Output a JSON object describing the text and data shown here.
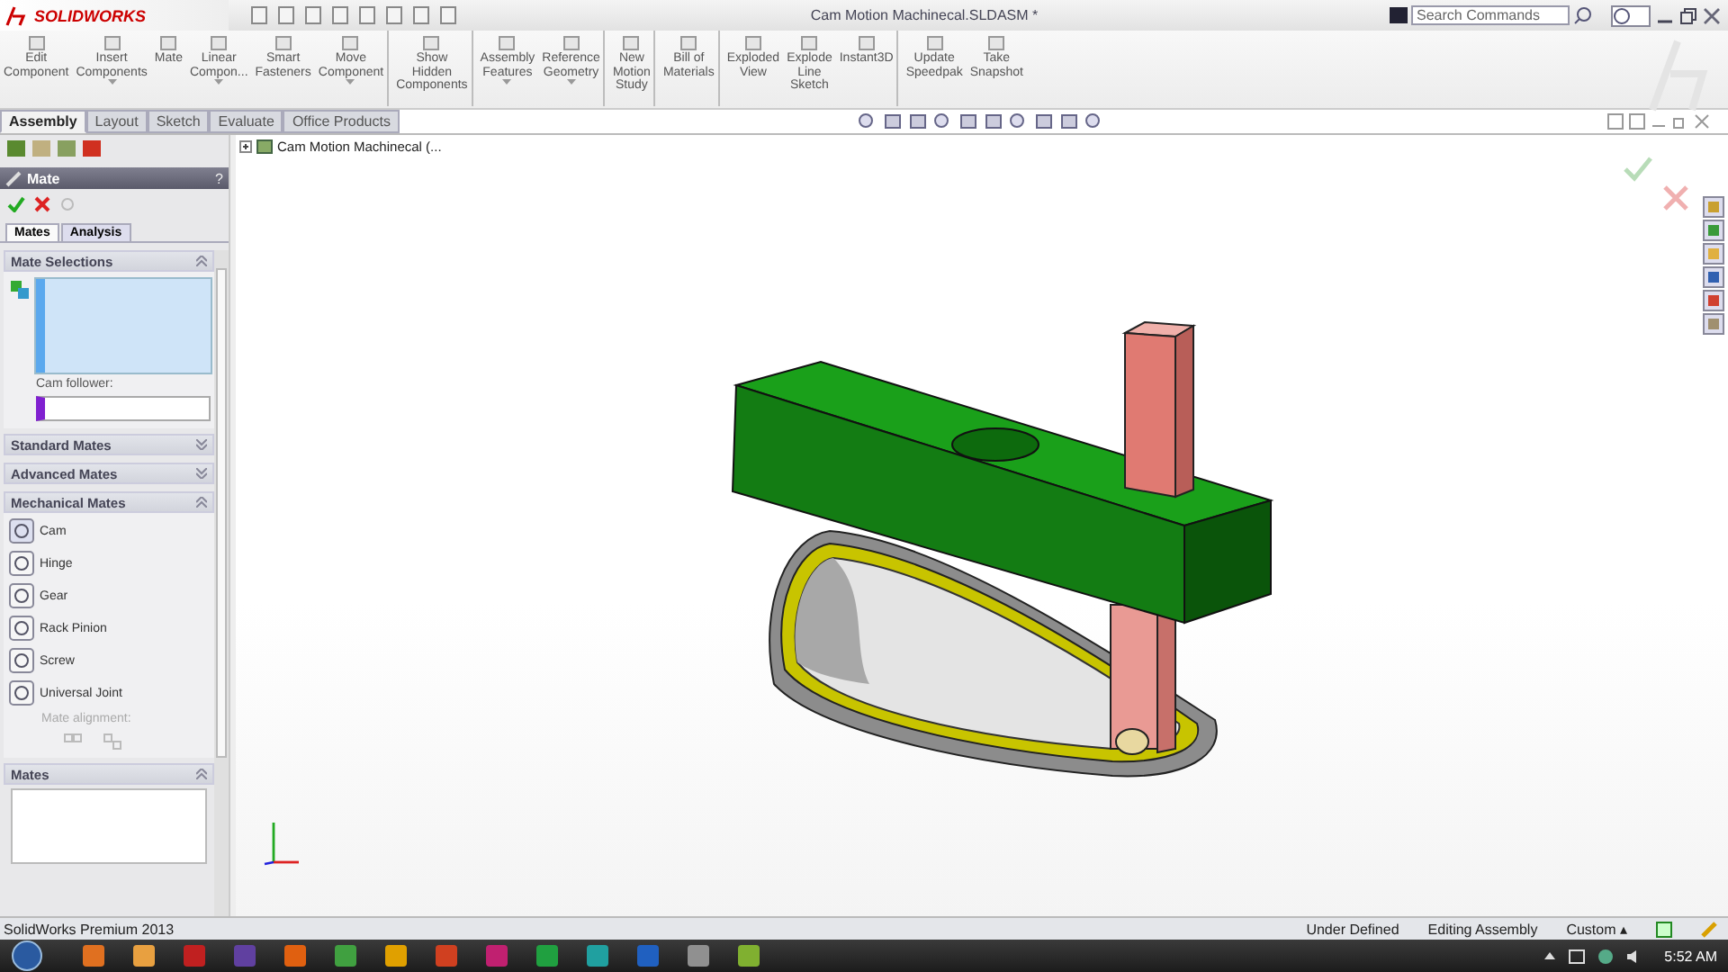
{
  "app": {
    "brand": "SOLIDWORKS",
    "title": "Cam Motion Machinecal.SLDASM *",
    "search": {
      "placeholder": "Search Commands"
    }
  },
  "ribbon": [
    {
      "label": "Edit\nComponent",
      "dropdown": false,
      "group_end": false
    },
    {
      "label": "Insert\nComponents",
      "dropdown": true,
      "group_end": false
    },
    {
      "label": "Mate",
      "dropdown": false,
      "group_end": false
    },
    {
      "label": "Linear\nCompon...",
      "dropdown": true,
      "group_end": false
    },
    {
      "label": "Smart\nFasteners",
      "dropdown": false,
      "group_end": false
    },
    {
      "label": "Move\nComponent",
      "dropdown": true,
      "group_end": true
    },
    {
      "label": "Show\nHidden\nComponents",
      "dropdown": false,
      "group_end": true
    },
    {
      "label": "Assembly\nFeatures",
      "dropdown": true,
      "group_end": false
    },
    {
      "label": "Reference\nGeometry",
      "dropdown": true,
      "group_end": true
    },
    {
      "label": "New\nMotion\nStudy",
      "dropdown": false,
      "group_end": true
    },
    {
      "label": "Bill of\nMaterials",
      "dropdown": false,
      "group_end": true
    },
    {
      "label": "Exploded\nView",
      "dropdown": false,
      "group_end": false
    },
    {
      "label": "Explode\nLine\nSketch",
      "dropdown": false,
      "group_end": false
    },
    {
      "label": "Instant3D",
      "dropdown": false,
      "group_end": true
    },
    {
      "label": "Update\nSpeedpak",
      "dropdown": false,
      "group_end": false
    },
    {
      "label": "Take\nSnapshot",
      "dropdown": false,
      "group_end": false
    }
  ],
  "tabs": [
    {
      "label": "Assembly",
      "selected": true
    },
    {
      "label": "Layout",
      "selected": false
    },
    {
      "label": "Sketch",
      "selected": false
    },
    {
      "label": "Evaluate",
      "selected": false
    },
    {
      "label": "Office Products",
      "selected": false
    }
  ],
  "tree": {
    "root": "Cam Motion Machinecal  (..."
  },
  "property_manager": {
    "title": "Mate",
    "help": "?",
    "tabs": [
      {
        "label": "Mates",
        "selected": true
      },
      {
        "label": "Analysis",
        "selected": false
      }
    ],
    "sections": [
      {
        "kind": "selections",
        "title": "Mate Selections",
        "expanded": true,
        "field_label": "Cam follower:"
      },
      {
        "kind": "plain",
        "title": "Standard Mates",
        "expanded": false
      },
      {
        "kind": "plain",
        "title": "Advanced Mates",
        "expanded": false
      },
      {
        "kind": "mate_types",
        "title": "Mechanical Mates",
        "expanded": true,
        "items": [
          {
            "label": "Cam",
            "selected": true
          },
          {
            "label": "Hinge",
            "selected": false
          },
          {
            "label": "Gear",
            "selected": false
          },
          {
            "label": "Rack Pinion",
            "selected": false
          },
          {
            "label": "Screw",
            "selected": false
          },
          {
            "label": "Universal Joint",
            "selected": false
          }
        ],
        "alignment_label": "Mate alignment:",
        "alignment_disabled": true
      },
      {
        "kind": "list",
        "title": "Mates",
        "expanded": true
      }
    ]
  },
  "status_bar": {
    "product": "SolidWorks Premium 2013",
    "state": "Under Defined",
    "mode": "Editing Assembly",
    "units": "Custom ▴"
  },
  "taskbar": {
    "clock": "5:52 AM"
  }
}
